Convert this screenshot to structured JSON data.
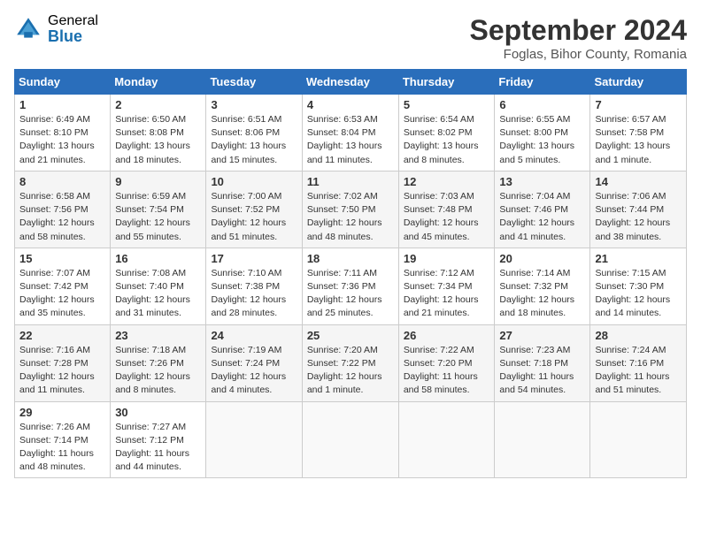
{
  "header": {
    "logo_general": "General",
    "logo_blue": "Blue",
    "month_title": "September 2024",
    "location": "Foglas, Bihor County, Romania"
  },
  "calendar": {
    "days_of_week": [
      "Sunday",
      "Monday",
      "Tuesday",
      "Wednesday",
      "Thursday",
      "Friday",
      "Saturday"
    ],
    "weeks": [
      [
        {
          "day": "1",
          "details": "Sunrise: 6:49 AM\nSunset: 8:10 PM\nDaylight: 13 hours\nand 21 minutes."
        },
        {
          "day": "2",
          "details": "Sunrise: 6:50 AM\nSunset: 8:08 PM\nDaylight: 13 hours\nand 18 minutes."
        },
        {
          "day": "3",
          "details": "Sunrise: 6:51 AM\nSunset: 8:06 PM\nDaylight: 13 hours\nand 15 minutes."
        },
        {
          "day": "4",
          "details": "Sunrise: 6:53 AM\nSunset: 8:04 PM\nDaylight: 13 hours\nand 11 minutes."
        },
        {
          "day": "5",
          "details": "Sunrise: 6:54 AM\nSunset: 8:02 PM\nDaylight: 13 hours\nand 8 minutes."
        },
        {
          "day": "6",
          "details": "Sunrise: 6:55 AM\nSunset: 8:00 PM\nDaylight: 13 hours\nand 5 minutes."
        },
        {
          "day": "7",
          "details": "Sunrise: 6:57 AM\nSunset: 7:58 PM\nDaylight: 13 hours\nand 1 minute."
        }
      ],
      [
        {
          "day": "8",
          "details": "Sunrise: 6:58 AM\nSunset: 7:56 PM\nDaylight: 12 hours\nand 58 minutes."
        },
        {
          "day": "9",
          "details": "Sunrise: 6:59 AM\nSunset: 7:54 PM\nDaylight: 12 hours\nand 55 minutes."
        },
        {
          "day": "10",
          "details": "Sunrise: 7:00 AM\nSunset: 7:52 PM\nDaylight: 12 hours\nand 51 minutes."
        },
        {
          "day": "11",
          "details": "Sunrise: 7:02 AM\nSunset: 7:50 PM\nDaylight: 12 hours\nand 48 minutes."
        },
        {
          "day": "12",
          "details": "Sunrise: 7:03 AM\nSunset: 7:48 PM\nDaylight: 12 hours\nand 45 minutes."
        },
        {
          "day": "13",
          "details": "Sunrise: 7:04 AM\nSunset: 7:46 PM\nDaylight: 12 hours\nand 41 minutes."
        },
        {
          "day": "14",
          "details": "Sunrise: 7:06 AM\nSunset: 7:44 PM\nDaylight: 12 hours\nand 38 minutes."
        }
      ],
      [
        {
          "day": "15",
          "details": "Sunrise: 7:07 AM\nSunset: 7:42 PM\nDaylight: 12 hours\nand 35 minutes."
        },
        {
          "day": "16",
          "details": "Sunrise: 7:08 AM\nSunset: 7:40 PM\nDaylight: 12 hours\nand 31 minutes."
        },
        {
          "day": "17",
          "details": "Sunrise: 7:10 AM\nSunset: 7:38 PM\nDaylight: 12 hours\nand 28 minutes."
        },
        {
          "day": "18",
          "details": "Sunrise: 7:11 AM\nSunset: 7:36 PM\nDaylight: 12 hours\nand 25 minutes."
        },
        {
          "day": "19",
          "details": "Sunrise: 7:12 AM\nSunset: 7:34 PM\nDaylight: 12 hours\nand 21 minutes."
        },
        {
          "day": "20",
          "details": "Sunrise: 7:14 AM\nSunset: 7:32 PM\nDaylight: 12 hours\nand 18 minutes."
        },
        {
          "day": "21",
          "details": "Sunrise: 7:15 AM\nSunset: 7:30 PM\nDaylight: 12 hours\nand 14 minutes."
        }
      ],
      [
        {
          "day": "22",
          "details": "Sunrise: 7:16 AM\nSunset: 7:28 PM\nDaylight: 12 hours\nand 11 minutes."
        },
        {
          "day": "23",
          "details": "Sunrise: 7:18 AM\nSunset: 7:26 PM\nDaylight: 12 hours\nand 8 minutes."
        },
        {
          "day": "24",
          "details": "Sunrise: 7:19 AM\nSunset: 7:24 PM\nDaylight: 12 hours\nand 4 minutes."
        },
        {
          "day": "25",
          "details": "Sunrise: 7:20 AM\nSunset: 7:22 PM\nDaylight: 12 hours\nand 1 minute."
        },
        {
          "day": "26",
          "details": "Sunrise: 7:22 AM\nSunset: 7:20 PM\nDaylight: 11 hours\nand 58 minutes."
        },
        {
          "day": "27",
          "details": "Sunrise: 7:23 AM\nSunset: 7:18 PM\nDaylight: 11 hours\nand 54 minutes."
        },
        {
          "day": "28",
          "details": "Sunrise: 7:24 AM\nSunset: 7:16 PM\nDaylight: 11 hours\nand 51 minutes."
        }
      ],
      [
        {
          "day": "29",
          "details": "Sunrise: 7:26 AM\nSunset: 7:14 PM\nDaylight: 11 hours\nand 48 minutes."
        },
        {
          "day": "30",
          "details": "Sunrise: 7:27 AM\nSunset: 7:12 PM\nDaylight: 11 hours\nand 44 minutes."
        },
        {
          "day": "",
          "details": ""
        },
        {
          "day": "",
          "details": ""
        },
        {
          "day": "",
          "details": ""
        },
        {
          "day": "",
          "details": ""
        },
        {
          "day": "",
          "details": ""
        }
      ]
    ]
  }
}
